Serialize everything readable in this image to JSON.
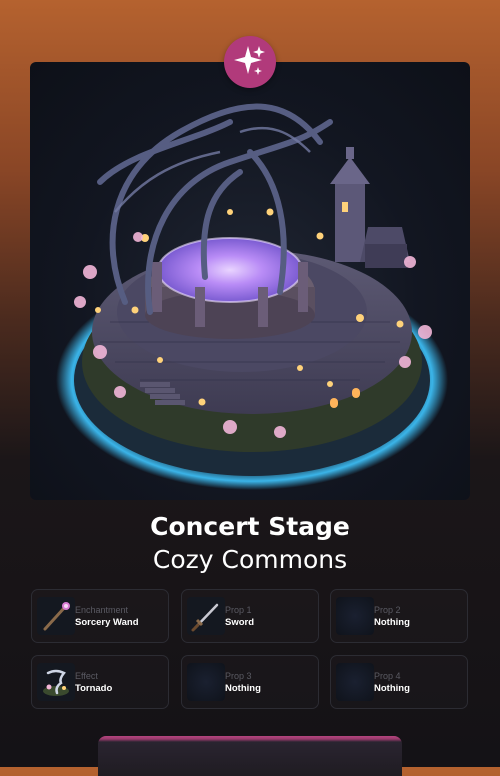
{
  "badge": {
    "icon": "sparkles-icon",
    "color": "#b13a7b"
  },
  "scene": {
    "icon": "concert-stage-island-illustration"
  },
  "item": {
    "title": "Concert Stage",
    "collection": "Cozy Commons"
  },
  "slots": [
    {
      "type": "Enchantment",
      "value": "Sorcery Wand",
      "icon": "wand-icon"
    },
    {
      "type": "Prop 1",
      "value": "Sword",
      "icon": "sword-icon"
    },
    {
      "type": "Prop 2",
      "value": "Nothing",
      "icon": "empty-slot-icon"
    },
    {
      "type": "Effect",
      "value": "Tornado",
      "icon": "tornado-icon"
    },
    {
      "type": "Prop 3",
      "value": "Nothing",
      "icon": "empty-slot-icon"
    },
    {
      "type": "Prop 4",
      "value": "Nothing",
      "icon": "empty-slot-icon"
    }
  ],
  "colors": {
    "accent": "#b13a7b",
    "glow": "#3fc6ff",
    "pool": "#c58bff"
  }
}
